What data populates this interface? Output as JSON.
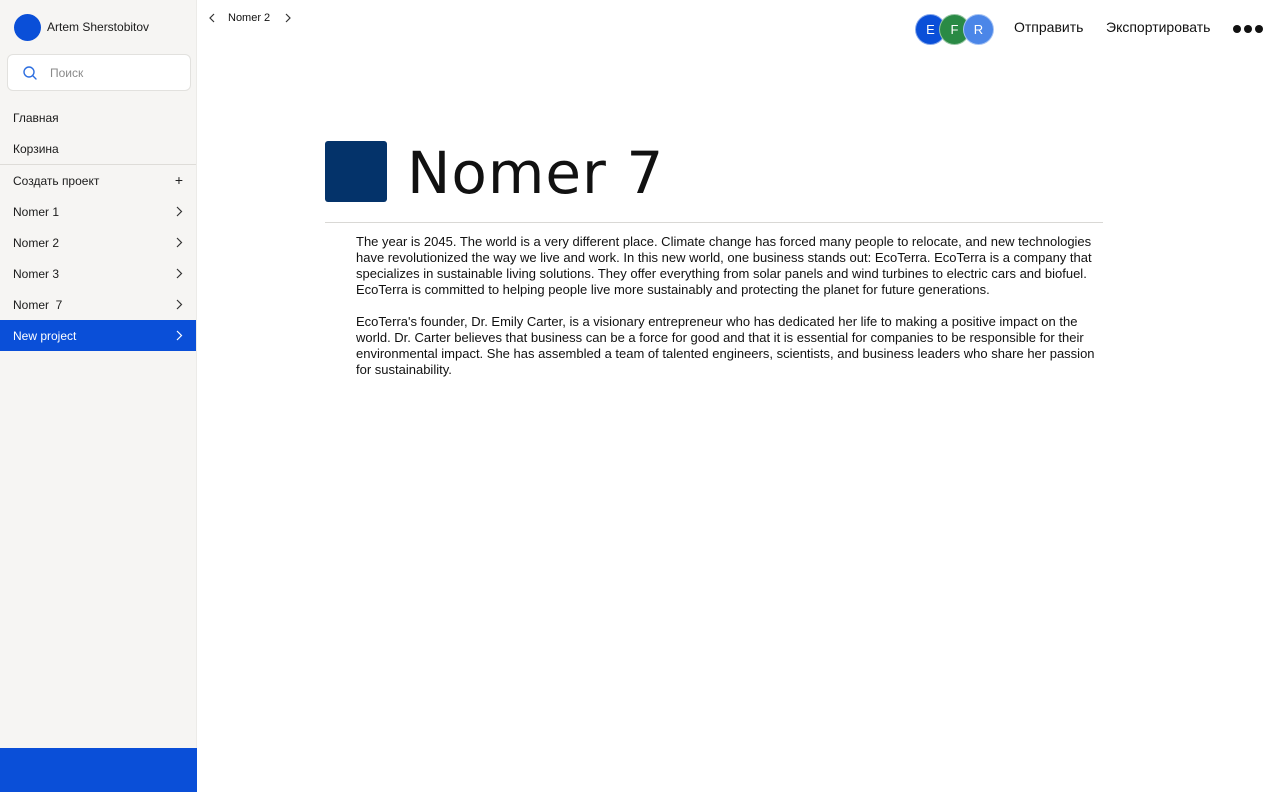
{
  "user": {
    "name": "Artem Sherstobitov"
  },
  "search": {
    "placeholder": "Поиск"
  },
  "nav": {
    "home": "Главная",
    "trash": "Корзина",
    "create_project": "Создать проект",
    "projects": [
      "Nomer 1",
      "Nomer 2",
      "Nomer 3",
      "Nomer  7",
      "New project"
    ],
    "active_index": 4
  },
  "breadcrumb": {
    "label": "Nomer 2"
  },
  "collaborators": [
    {
      "initial": "E",
      "color": "#0a4fd8"
    },
    {
      "initial": "F",
      "color": "#2a8a45"
    },
    {
      "initial": "R",
      "color": "#4b86e8"
    }
  ],
  "toolbar": {
    "send_label": "Отправить",
    "export_label": "Экспортировать"
  },
  "document": {
    "title": "Nomer 7",
    "icon_color": "#04336a",
    "paragraphs": [
      "The year is 2045. The world is a very different place. Climate change has forced many people to relocate, and new technologies have revolutionized the way we live and work. In this new world, one business stands out: EcoTerra. EcoTerra is a company that specializes in sustainable living solutions. They offer everything from solar panels and wind turbines to electric cars and biofuel. EcoTerra is committed to helping people live more sustainably and protecting the planet for future generations.",
      "EcoTerra's founder, Dr. Emily Carter, is a visionary entrepreneur who has dedicated her life to making a positive impact on the world. Dr. Carter believes that business can be a force for good and that it is essential for companies to be responsible for their environmental impact. She has assembled a team of talented engineers, scientists, and business leaders who share her passion for sustainability."
    ]
  },
  "colors": {
    "accent": "#0a4fd8",
    "sidebar_bg": "#f6f5f3"
  }
}
